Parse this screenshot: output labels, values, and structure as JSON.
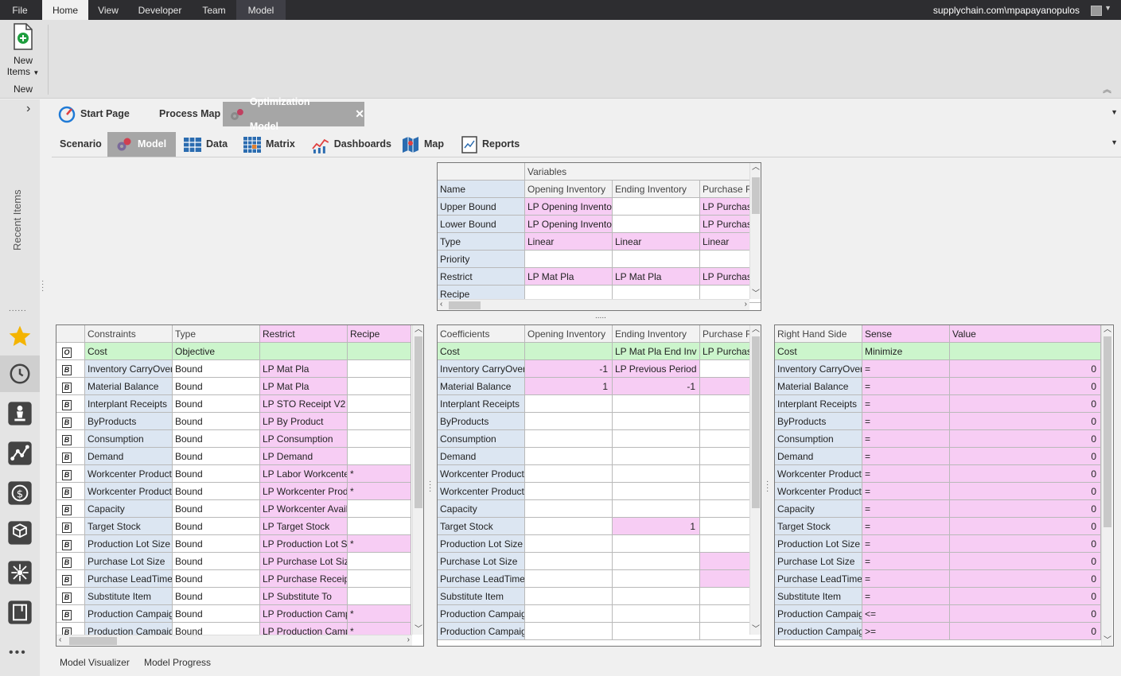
{
  "menubar": {
    "items": [
      "File",
      "Home",
      "View",
      "Developer",
      "Team",
      "Model"
    ],
    "account": "supplychain.com\\mpapayanopulos"
  },
  "ribbon": {
    "new_items_label": "New",
    "new_items_label2": "Items",
    "group_label": "New"
  },
  "sidebar": {
    "recent_label": "Recent Items"
  },
  "doc_tabs": [
    "Start Page",
    "Process Map",
    "Optimization Model"
  ],
  "sub_tabs": [
    "Scenario",
    "Model",
    "Data",
    "Matrix",
    "Dashboards",
    "Map",
    "Reports"
  ],
  "variables_grid": {
    "group_header": "Variables",
    "columns": [
      "Opening Inventory",
      "Ending Inventory",
      "Purchase R"
    ],
    "rows": [
      {
        "label": "Name",
        "cells": [
          "Opening Inventory",
          "Ending Inventory",
          "Purchase R"
        ]
      },
      {
        "label": "Upper Bound",
        "cells": [
          "LP Opening Invento",
          "",
          "LP Purchas"
        ]
      },
      {
        "label": "Lower Bound",
        "cells": [
          "LP Opening Invento",
          "",
          "LP Purchas"
        ]
      },
      {
        "label": "Type",
        "cells": [
          "Linear",
          "Linear",
          "Linear"
        ]
      },
      {
        "label": "Priority",
        "cells": [
          "",
          "",
          ""
        ]
      },
      {
        "label": "Restrict",
        "cells": [
          "LP Mat Pla",
          "LP Mat Pla",
          "LP Purchas"
        ]
      },
      {
        "label": "Recipe",
        "cells": [
          "",
          "",
          ""
        ]
      }
    ]
  },
  "constraints_grid": {
    "headers": [
      "Constraints",
      "Type",
      "Restrict",
      "Recipe"
    ],
    "rows": [
      {
        "badge": "O",
        "name": "Cost",
        "type": "Objective",
        "restrict": "",
        "recipe": ""
      },
      {
        "badge": "B",
        "name": "Inventory CarryOver",
        "type": "Bound",
        "restrict": "LP Mat Pla",
        "recipe": ""
      },
      {
        "badge": "B",
        "name": "Material Balance",
        "type": "Bound",
        "restrict": "LP Mat Pla",
        "recipe": ""
      },
      {
        "badge": "B",
        "name": "Interplant Receipts",
        "type": "Bound",
        "restrict": "LP STO Receipt V2",
        "recipe": ""
      },
      {
        "badge": "B",
        "name": "ByProducts",
        "type": "Bound",
        "restrict": "LP By Product",
        "recipe": ""
      },
      {
        "badge": "B",
        "name": "Consumption",
        "type": "Bound",
        "restrict": "LP Consumption",
        "recipe": ""
      },
      {
        "badge": "B",
        "name": "Demand",
        "type": "Bound",
        "restrict": "LP Demand",
        "recipe": ""
      },
      {
        "badge": "B",
        "name": "Workcenter Product",
        "type": "Bound",
        "restrict": "LP Labor Workcente",
        "recipe": "*"
      },
      {
        "badge": "B",
        "name": "Workcenter Product",
        "type": "Bound",
        "restrict": "LP Workcenter Prod",
        "recipe": "*"
      },
      {
        "badge": "B",
        "name": "Capacity",
        "type": "Bound",
        "restrict": "LP Workcenter Avail",
        "recipe": ""
      },
      {
        "badge": "B",
        "name": "Target Stock",
        "type": "Bound",
        "restrict": "LP Target Stock",
        "recipe": ""
      },
      {
        "badge": "B",
        "name": "Production Lot Size",
        "type": "Bound",
        "restrict": "LP Production Lot S",
        "recipe": "*"
      },
      {
        "badge": "B",
        "name": "Purchase Lot Size",
        "type": "Bound",
        "restrict": "LP Purchase Lot Size",
        "recipe": ""
      },
      {
        "badge": "B",
        "name": "Purchase LeadTime",
        "type": "Bound",
        "restrict": "LP Purchase Receipt",
        "recipe": ""
      },
      {
        "badge": "B",
        "name": "Substitute Item",
        "type": "Bound",
        "restrict": "LP Substitute To",
        "recipe": ""
      },
      {
        "badge": "B",
        "name": "Production Campaign",
        "type": "Bound",
        "restrict": "LP Production Camp",
        "recipe": "*"
      },
      {
        "badge": "B",
        "name": "Production Campaign",
        "type": "Bound",
        "restrict": "LP Production Camp",
        "recipe": "*"
      }
    ]
  },
  "coefficients_grid": {
    "headers": [
      "Coefficients",
      "Opening Inventory",
      "Ending Inventory",
      "Purchase R"
    ],
    "rows": [
      {
        "name": "Cost",
        "c1": "",
        "c2": "LP Mat Pla End Inv",
        "c3": "LP Purchas"
      },
      {
        "name": "Inventory CarryOver",
        "c1": "-1",
        "c2": "LP Previous Period",
        "c3": ""
      },
      {
        "name": "Material Balance",
        "c1": "1",
        "c2": "-1",
        "c3": ""
      },
      {
        "name": "Interplant Receipts",
        "c1": "",
        "c2": "",
        "c3": ""
      },
      {
        "name": "ByProducts",
        "c1": "",
        "c2": "",
        "c3": ""
      },
      {
        "name": "Consumption",
        "c1": "",
        "c2": "",
        "c3": ""
      },
      {
        "name": "Demand",
        "c1": "",
        "c2": "",
        "c3": ""
      },
      {
        "name": "Workcenter Product",
        "c1": "",
        "c2": "",
        "c3": ""
      },
      {
        "name": "Workcenter Product",
        "c1": "",
        "c2": "",
        "c3": ""
      },
      {
        "name": "Capacity",
        "c1": "",
        "c2": "",
        "c3": ""
      },
      {
        "name": "Target Stock",
        "c1": "",
        "c2": "1",
        "c3": ""
      },
      {
        "name": "Production Lot Size",
        "c1": "",
        "c2": "",
        "c3": ""
      },
      {
        "name": "Purchase Lot Size",
        "c1": "",
        "c2": "",
        "c3": ""
      },
      {
        "name": "Purchase LeadTime",
        "c1": "",
        "c2": "",
        "c3": ""
      },
      {
        "name": "Substitute Item",
        "c1": "",
        "c2": "",
        "c3": ""
      },
      {
        "name": "Production Campaign",
        "c1": "",
        "c2": "",
        "c3": ""
      },
      {
        "name": "Production Campaign",
        "c1": "",
        "c2": "",
        "c3": ""
      }
    ]
  },
  "rhs_grid": {
    "headers": [
      "Right Hand Side",
      "Sense",
      "Value"
    ],
    "rows": [
      {
        "name": "Cost",
        "sense": "Minimize",
        "value": ""
      },
      {
        "name": "Inventory CarryOver",
        "sense": "=",
        "value": "0"
      },
      {
        "name": "Material Balance",
        "sense": "=",
        "value": "0"
      },
      {
        "name": "Interplant Receipts",
        "sense": "=",
        "value": "0"
      },
      {
        "name": "ByProducts",
        "sense": "=",
        "value": "0"
      },
      {
        "name": "Consumption",
        "sense": "=",
        "value": "0"
      },
      {
        "name": "Demand",
        "sense": "=",
        "value": "0"
      },
      {
        "name": "Workcenter Product",
        "sense": "=",
        "value": "0"
      },
      {
        "name": "Workcenter Product",
        "sense": "=",
        "value": "0"
      },
      {
        "name": "Capacity",
        "sense": "=",
        "value": "0"
      },
      {
        "name": "Target Stock",
        "sense": "=",
        "value": "0"
      },
      {
        "name": "Production Lot Size",
        "sense": "=",
        "value": "0"
      },
      {
        "name": "Purchase Lot Size",
        "sense": "=",
        "value": "0"
      },
      {
        "name": "Purchase LeadTime",
        "sense": "=",
        "value": "0"
      },
      {
        "name": "Substitute Item",
        "sense": "=",
        "value": "0"
      },
      {
        "name": "Production Campaign",
        "sense": "<=",
        "value": "0"
      },
      {
        "name": "Production Campaign",
        "sense": ">=",
        "value": "0"
      }
    ]
  },
  "bottom_tabs": [
    "Model Visualizer",
    "Model Progress"
  ],
  "colors": {
    "blue": "#dce6f2",
    "pink": "#f7cdf4",
    "green": "#ccf5cc",
    "active_tab": "#a6a6a6"
  }
}
